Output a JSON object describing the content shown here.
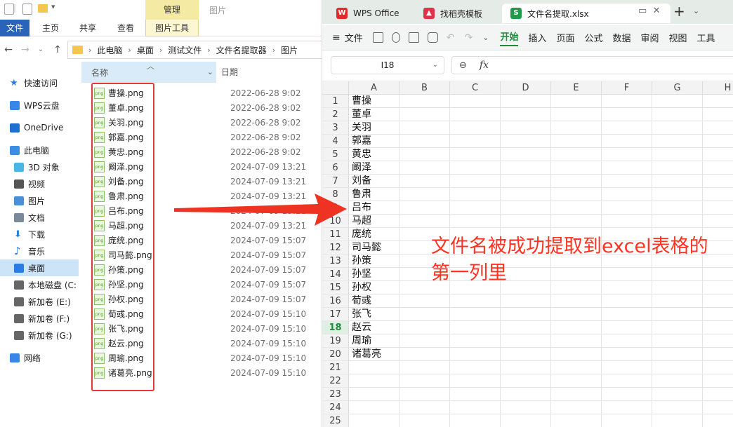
{
  "explorer": {
    "manage_label": "管理",
    "window_title": "图片",
    "ribbon_tabs": [
      "文件",
      "主页",
      "共享",
      "查看",
      "图片工具"
    ],
    "breadcrumb": [
      "此电脑",
      "桌面",
      "测试文件",
      "文件名提取器",
      "图片"
    ],
    "columns": {
      "name": "名称",
      "date": "日期"
    },
    "nav_items": [
      {
        "label": "快速访问",
        "icon": "star-icon",
        "color": "#2a7be4"
      },
      {
        "label": "WPS云盘",
        "icon": "cloud-icon",
        "color": "#3a86e8"
      },
      {
        "label": "OneDrive",
        "icon": "onedrive-icon",
        "color": "#1f6fd0"
      },
      {
        "label": "此电脑",
        "icon": "computer-icon",
        "color": "#3a8de0"
      },
      {
        "label": "3D 对象",
        "icon": "cube-icon",
        "color": "#49b6e6"
      },
      {
        "label": "视频",
        "icon": "video-icon",
        "color": "#555555"
      },
      {
        "label": "图片",
        "icon": "picture-icon",
        "color": "#4a90d9"
      },
      {
        "label": "文档",
        "icon": "document-icon",
        "color": "#7a8a9a"
      },
      {
        "label": "下载",
        "icon": "download-icon",
        "color": "#2a7be4"
      },
      {
        "label": "音乐",
        "icon": "music-icon",
        "color": "#2a7be4"
      },
      {
        "label": "桌面",
        "icon": "desktop-icon",
        "color": "#2a7be4"
      },
      {
        "label": "本地磁盘 (C:",
        "icon": "drive-icon",
        "color": "#666666"
      },
      {
        "label": "新加卷 (E:)",
        "icon": "drive-icon",
        "color": "#666666"
      },
      {
        "label": "新加卷 (F:)",
        "icon": "drive-icon",
        "color": "#666666"
      },
      {
        "label": "新加卷 (G:)",
        "icon": "drive-icon",
        "color": "#666666"
      },
      {
        "label": "网络",
        "icon": "network-icon",
        "color": "#3a86e8"
      }
    ],
    "selected_nav": "桌面",
    "files": [
      {
        "name": "曹操.png",
        "date": "2022-06-28 9:02"
      },
      {
        "name": "董卓.png",
        "date": "2022-06-28 9:02"
      },
      {
        "name": "关羽.png",
        "date": "2022-06-28 9:02"
      },
      {
        "name": "郭嘉.png",
        "date": "2022-06-28 9:02"
      },
      {
        "name": "黄忠.png",
        "date": "2022-06-28 9:02"
      },
      {
        "name": "阚泽.png",
        "date": "2024-07-09 13:21"
      },
      {
        "name": "刘备.png",
        "date": "2024-07-09 13:21"
      },
      {
        "name": "鲁肃.png",
        "date": "2024-07-09 13:21"
      },
      {
        "name": "吕布.png",
        "date": "2024-07-09 13:21"
      },
      {
        "name": "马超.png",
        "date": "2024-07-09 13:21"
      },
      {
        "name": "庞统.png",
        "date": "2024-07-09 15:07"
      },
      {
        "name": "司马懿.png",
        "date": "2024-07-09 15:07"
      },
      {
        "name": "孙策.png",
        "date": "2024-07-09 15:07"
      },
      {
        "name": "孙坚.png",
        "date": "2024-07-09 15:07"
      },
      {
        "name": "孙权.png",
        "date": "2024-07-09 15:07"
      },
      {
        "name": "荀彧.png",
        "date": "2024-07-09 15:10"
      },
      {
        "name": "张飞.png",
        "date": "2024-07-09 15:10"
      },
      {
        "name": "赵云.png",
        "date": "2024-07-09 15:10"
      },
      {
        "name": "周瑜.png",
        "date": "2024-07-09 15:10"
      },
      {
        "name": "诸葛亮.png",
        "date": "2024-07-09 15:10"
      }
    ]
  },
  "wps": {
    "tabs": [
      "WPS Office",
      "找稻壳模板",
      "文件名提取.xlsx"
    ],
    "toolbar_file": "文件",
    "ribbon_tabs": [
      "开始",
      "插入",
      "页面",
      "公式",
      "数据",
      "审阅",
      "视图",
      "工具"
    ],
    "active_tab": "开始",
    "name_box": "I18",
    "fx_label": "fx",
    "columns": [
      "A",
      "B",
      "C",
      "D",
      "E",
      "F",
      "G",
      "H"
    ],
    "rows": [
      "1",
      "2",
      "3",
      "4",
      "5",
      "6",
      "7",
      "8",
      "9",
      "10",
      "11",
      "12",
      "13",
      "14",
      "15",
      "16",
      "17",
      "18",
      "19",
      "20",
      "21",
      "22",
      "23",
      "24",
      "25"
    ],
    "selected_row": "18",
    "col_a_values": [
      "曹操",
      "董卓",
      "关羽",
      "郭嘉",
      "黄忠",
      "阚泽",
      "刘备",
      "鲁肃",
      "吕布",
      "马超",
      "庞统",
      "司马懿",
      "孙策",
      "孙坚",
      "孙权",
      "荀彧",
      "张飞",
      "赵云",
      "周瑜",
      "诸葛亮"
    ],
    "accent": "#1f8b3a"
  },
  "annotation": {
    "text": "文件名被成功提取到excel表格的第一列里",
    "color": "#ff3322",
    "arrow_color": "#ee3322"
  }
}
